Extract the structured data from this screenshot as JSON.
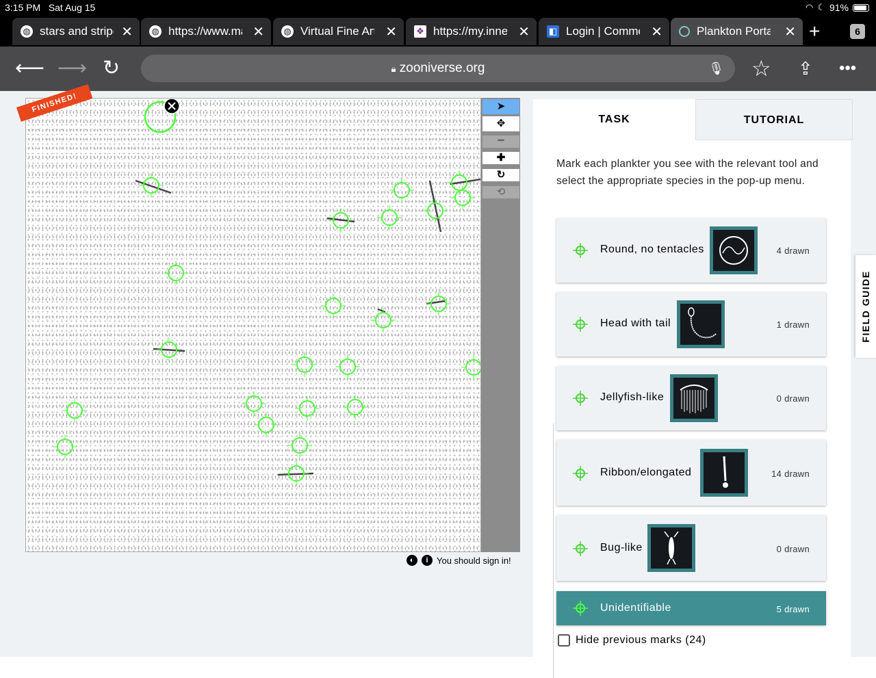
{
  "status": {
    "time": "3:15 PM",
    "date": "Sat Aug 15",
    "battery": "91%",
    "battery_level": 0.91
  },
  "tabs": [
    {
      "title": "stars and stripe",
      "favicon": "globe-icon"
    },
    {
      "title": "https://www.ma",
      "favicon": "globe-icon"
    },
    {
      "title": "Virtual Fine Art",
      "favicon": "globe-icon"
    },
    {
      "title": "https://my.inne",
      "favicon": "heart-grid-icon"
    },
    {
      "title": "Login | Commo",
      "favicon": "box-icon"
    },
    {
      "title": "Plankton Portal",
      "favicon": "zooniverse-icon"
    }
  ],
  "tab_count": "6",
  "url": "zooniverse.org",
  "banner": "FINISHED!",
  "tools": {
    "active": "pointer-tool"
  },
  "footer_note": "You should sign in!",
  "panel": {
    "tab_task": "TASK",
    "tab_tutorial": "TUTORIAL",
    "instructions": "Mark each plankter you see with the relevant tool and select the appropriate species in the pop-up menu.",
    "options": [
      {
        "label": "Round, no tentacles",
        "count": "4 drawn"
      },
      {
        "label": "Head with tail",
        "count": "1 drawn"
      },
      {
        "label": "Jellyfish-like",
        "count": "0 drawn"
      },
      {
        "label": "Ribbon/elongated",
        "count": "14 drawn"
      },
      {
        "label": "Bug-like",
        "count": "0 drawn"
      },
      {
        "label": "Unidentifiable",
        "count": "5 drawn"
      }
    ],
    "hide_marks": "Hide previous marks (24)"
  },
  "field_guide": "FIELD GUIDE",
  "colors": {
    "accent": "#3f8f93",
    "marker": "#4cff3a",
    "banner": "#e8461c",
    "active_tool": "#6db0f3"
  }
}
